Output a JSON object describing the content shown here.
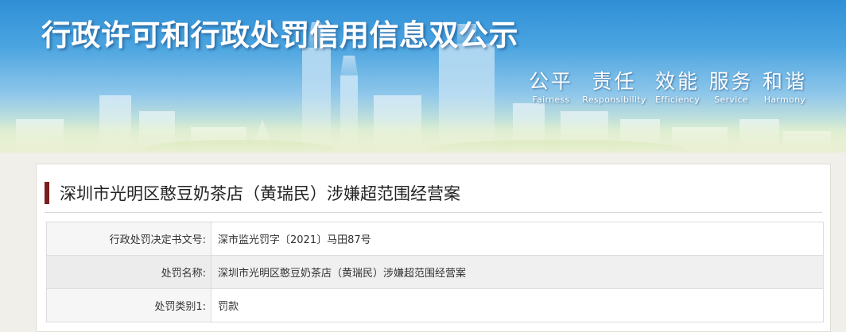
{
  "banner": {
    "title": "行政许可和行政处罚信用信息双公示",
    "slogans": [
      {
        "cn": "公平",
        "en": "Fairness"
      },
      {
        "cn": "责任",
        "en": "Responsibility"
      },
      {
        "cn": "效能",
        "en": "Efficiency"
      },
      {
        "cn": "服务",
        "en": "Service"
      },
      {
        "cn": "和谐",
        "en": "Harmony"
      }
    ]
  },
  "case": {
    "title": "深圳市光明区憨豆奶茶店（黄瑞民）涉嫌超范围经营案",
    "rows": [
      {
        "label": "行政处罚决定书文号:",
        "value": "深市监光罚字〔2021〕马田87号"
      },
      {
        "label": "处罚名称:",
        "value": "深圳市光明区憨豆奶茶店（黄瑞民）涉嫌超范围经营案"
      },
      {
        "label": "处罚类别1:",
        "value": "罚款"
      }
    ]
  },
  "colors": {
    "title_accent": "#7a1e1e",
    "banner_sky": "#3b97dc"
  }
}
